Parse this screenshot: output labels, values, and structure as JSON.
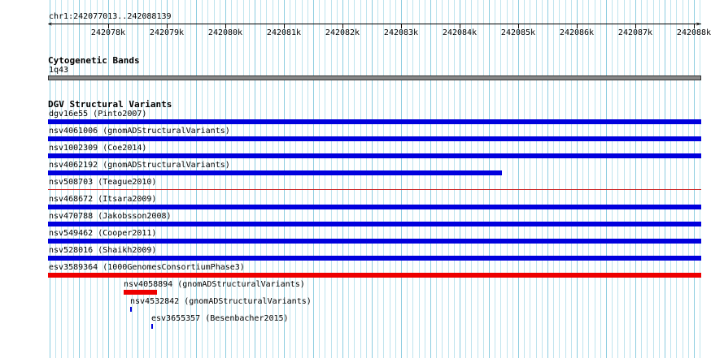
{
  "ruler": {
    "location": "chr1:242077013..242088139",
    "tick_labels": [
      "242078k",
      "242079k",
      "242080k",
      "242081k",
      "242082k",
      "242083k",
      "242084k",
      "242085k",
      "242086k",
      "242087k",
      "242088k"
    ]
  },
  "tracks": {
    "cytogenetic": {
      "title": "Cytogenetic Bands",
      "band": "1q43",
      "color": "#888888"
    },
    "dgv": {
      "title": "DGV Structural Variants",
      "features": [
        {
          "label": "dgv16e55 (Pinto2007)",
          "color": "#0000dd"
        },
        {
          "label": "nsv4061006 (gnomADStructuralVariants)",
          "color": "#0000dd"
        },
        {
          "label": "nsv1002309 (Coe2014)",
          "color": "#0000dd"
        },
        {
          "label": "nsv4062192 (gnomADStructuralVariants)",
          "color": "#0000dd"
        },
        {
          "label": "nsv508703 (Teague2010)",
          "color": "#cc2222"
        },
        {
          "label": "nsv468672 (Itsara2009)",
          "color": "#0000dd"
        },
        {
          "label": "nsv470788 (Jakobsson2008)",
          "color": "#0000dd"
        },
        {
          "label": "nsv549462 (Cooper2011)",
          "color": "#0000dd"
        },
        {
          "label": "nsv528016 (Shaikh2009)",
          "color": "#0000dd"
        },
        {
          "label": "esv3589364 (1000GenomesConsortiumPhase3)",
          "color": "#ee0000"
        },
        {
          "label": "nsv4058894 (gnomADStructuralVariants)",
          "color": "#ee0000"
        },
        {
          "label": "nsv4532842 (gnomADStructuralVariants)",
          "color": "#0000dd"
        },
        {
          "label": "esv3655357 (Besenbacher2015)",
          "color": "#0000dd"
        }
      ]
    }
  }
}
